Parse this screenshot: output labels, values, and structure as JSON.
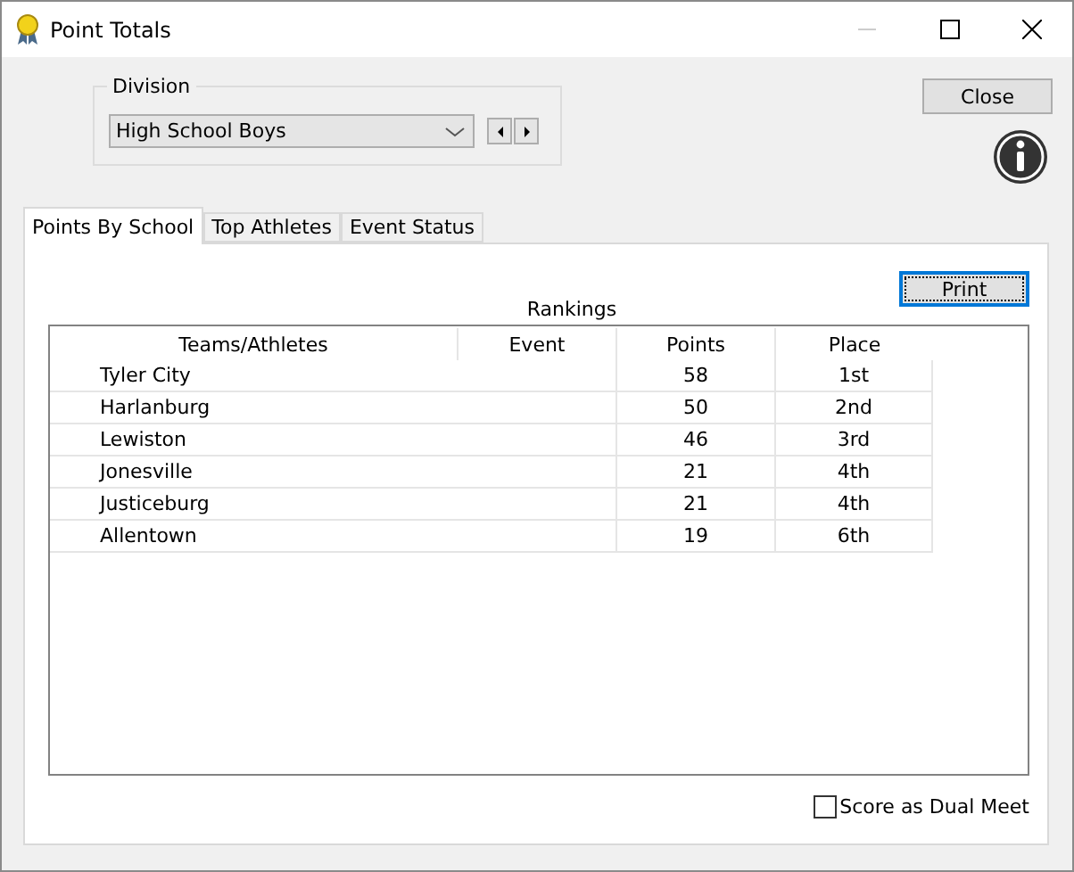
{
  "window": {
    "title": "Point Totals"
  },
  "division": {
    "label": "Division",
    "value": "High School Boys"
  },
  "close_button": "Close",
  "tabs": [
    {
      "label": "Points By School",
      "selected": true
    },
    {
      "label": "Top Athletes",
      "selected": false
    },
    {
      "label": "Event Status",
      "selected": false
    }
  ],
  "rankings": {
    "title": "Rankings",
    "print_button": "Print",
    "columns": [
      "Teams/Athletes",
      "Event",
      "Points",
      "Place"
    ],
    "rows": [
      [
        "Tyler City",
        "",
        "58",
        "1st"
      ],
      [
        "Harlanburg",
        "",
        "50",
        "2nd"
      ],
      [
        "Lewiston",
        "",
        "46",
        "3rd"
      ],
      [
        "Jonesville",
        "",
        "21",
        "4th"
      ],
      [
        "Justiceburg",
        "",
        "21",
        "4th"
      ],
      [
        "Allentown",
        "",
        "19",
        "6th"
      ]
    ]
  },
  "dual_meet": {
    "label": "Score as Dual Meet",
    "checked": false
  }
}
